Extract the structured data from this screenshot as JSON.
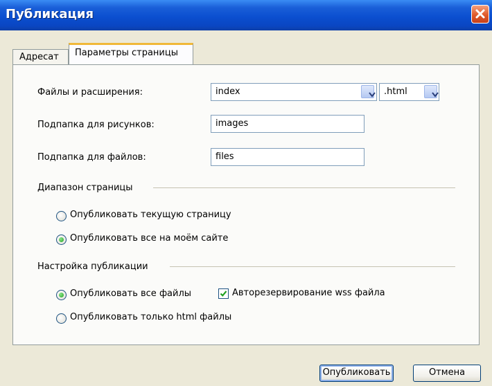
{
  "window": {
    "title": "Публикация"
  },
  "tabs": [
    {
      "label": "Адресат"
    },
    {
      "label": "Параметры страницы"
    }
  ],
  "fields": {
    "files_label": "Файлы и расширения:",
    "filename_value": "index",
    "extension_value": ".html",
    "images_label": "Подпапка для рисунков:",
    "images_value": "images",
    "files_folder_label": "Подпапка для файлов:",
    "files_folder_value": "files"
  },
  "page_range": {
    "group_label": "Диапазон страницы",
    "option_current": "Опубликовать текущую страницу",
    "option_all": "Опубликовать все на моём сайте",
    "selected": "all"
  },
  "publish_settings": {
    "group_label": "Настройка публикации",
    "option_all_files": "Опубликовать все файлы",
    "option_html_only": "Опубликовать только html файлы",
    "backup_label": "Авторезервирование wss файла",
    "backup_checked": true,
    "selected": "all_files"
  },
  "buttons": {
    "publish": "Опубликовать",
    "cancel": "Отмена"
  },
  "colors": {
    "titlebar": "#0b4fd0",
    "dialog_bg": "#ece9d8",
    "tab_highlight": "#f0b838"
  }
}
